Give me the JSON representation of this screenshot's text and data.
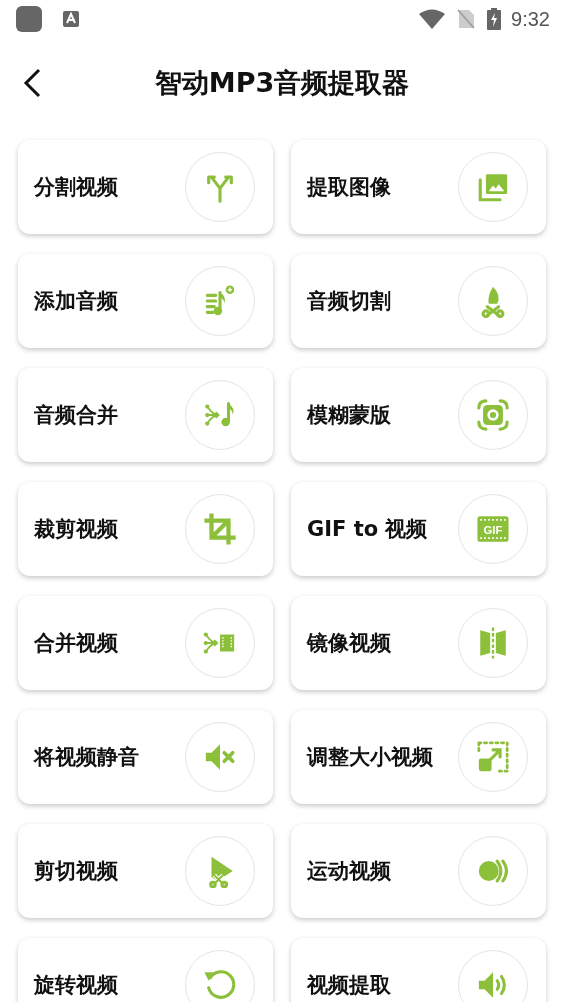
{
  "status_bar": {
    "time": "9:32"
  },
  "header": {
    "title": "智动MP3音频提取器"
  },
  "tools": [
    {
      "label": "分割视频"
    },
    {
      "label": "提取图像"
    },
    {
      "label": "添加音频"
    },
    {
      "label": "音频切割"
    },
    {
      "label": "音频合并"
    },
    {
      "label": "模糊蒙版"
    },
    {
      "label": "裁剪视频"
    },
    {
      "label": "GIF to 视频",
      "icon_text": "GIF"
    },
    {
      "label": "合并视频"
    },
    {
      "label": "镜像视频"
    },
    {
      "label": "将视频静音"
    },
    {
      "label": "调整大小视频"
    },
    {
      "label": "剪切视频"
    },
    {
      "label": "运动视频"
    },
    {
      "label": "旋转视频"
    },
    {
      "label": "视频提取"
    }
  ]
}
